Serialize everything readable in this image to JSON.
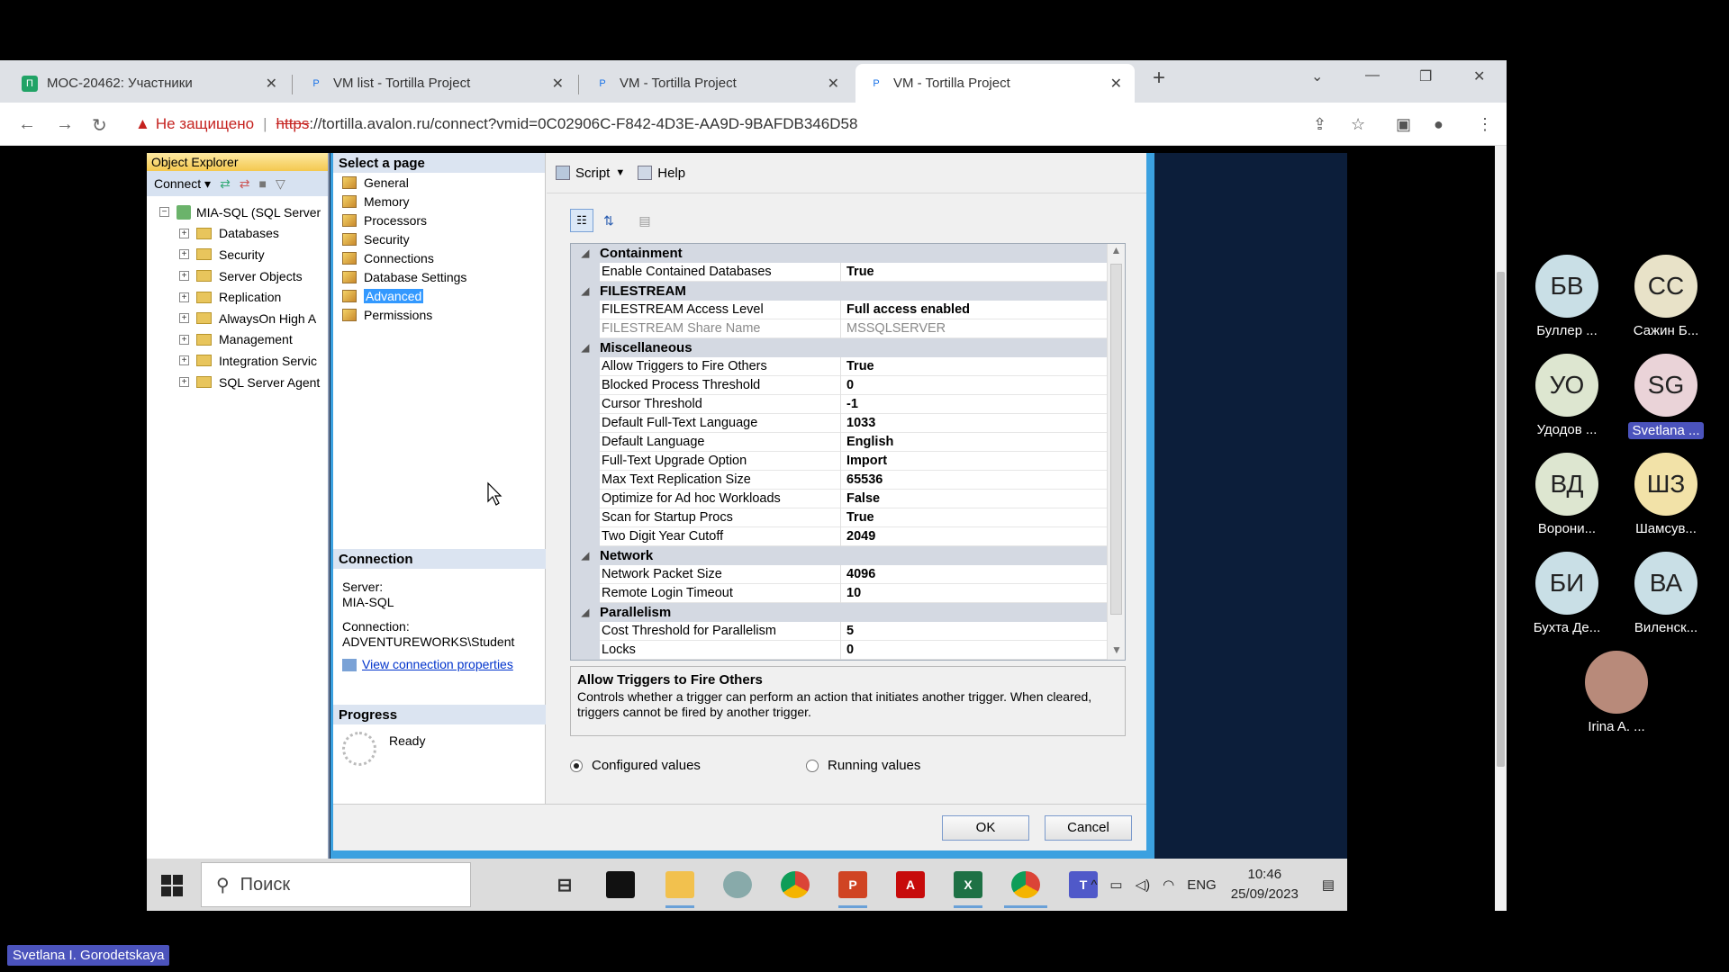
{
  "tabs": [
    {
      "title": "MOC-20462: Участники",
      "fav": "П",
      "favcolor": "#21a366"
    },
    {
      "title": "VM list - Tortilla Project",
      "fav": "P",
      "favcolor": "#1a73e8"
    },
    {
      "title": "VM - Tortilla Project",
      "fav": "P",
      "favcolor": "#1a73e8"
    },
    {
      "title": "VM - Tortilla Project",
      "fav": "P",
      "favcolor": "#1a73e8"
    }
  ],
  "address": {
    "warning": "Не защищено",
    "scheme": "https",
    "rest": "://tortilla.avalon.ru/connect?vmid=0C02906C-F842-4D3E-AA9D-9BAFDB346D58"
  },
  "oe": {
    "title": "Object Explorer",
    "connect": "Connect ▾",
    "server": "MIA-SQL (SQL Server",
    "nodes": [
      "Databases",
      "Security",
      "Server Objects",
      "Replication",
      "AlwaysOn High A",
      "Management",
      "Integration Servic",
      "SQL Server Agent"
    ]
  },
  "dialog": {
    "select_page": "Select a page",
    "pages": [
      "General",
      "Memory",
      "Processors",
      "Security",
      "Connections",
      "Database Settings",
      "Advanced",
      "Permissions"
    ],
    "selected_page": "Advanced",
    "script": "Script",
    "help": "Help",
    "connection_hdr": "Connection",
    "server_label": "Server:",
    "server_value": "MIA-SQL",
    "connection_label": "Connection:",
    "connection_value": "ADVENTUREWORKS\\Student",
    "view_props": "View connection properties",
    "progress_hdr": "Progress",
    "progress_status": "Ready",
    "desc_title": "Allow Triggers to Fire Others",
    "desc_text": "Controls whether a trigger can perform an action that initiates another trigger. When cleared, triggers cannot be fired by another trigger.",
    "radio_configured": "Configured values",
    "radio_running": "Running values",
    "ok": "OK",
    "cancel": "Cancel"
  },
  "grid": [
    {
      "cat": "Containment",
      "rows": [
        [
          "Enable Contained Databases",
          "True",
          false
        ]
      ]
    },
    {
      "cat": "FILESTREAM",
      "rows": [
        [
          "FILESTREAM Access Level",
          "Full access enabled",
          false
        ],
        [
          "FILESTREAM Share Name",
          "MSSQLSERVER",
          true
        ]
      ]
    },
    {
      "cat": "Miscellaneous",
      "rows": [
        [
          "Allow Triggers to Fire Others",
          "True",
          false
        ],
        [
          "Blocked Process Threshold",
          "0",
          false
        ],
        [
          "Cursor Threshold",
          "-1",
          false
        ],
        [
          "Default Full-Text Language",
          "1033",
          false
        ],
        [
          "Default Language",
          "English",
          false
        ],
        [
          "Full-Text Upgrade Option",
          "Import",
          false
        ],
        [
          "Max Text Replication Size",
          "65536",
          false
        ],
        [
          "Optimize for Ad hoc Workloads",
          "False",
          false
        ],
        [
          "Scan for Startup Procs",
          "True",
          false
        ],
        [
          "Two Digit Year Cutoff",
          "2049",
          false
        ]
      ]
    },
    {
      "cat": "Network",
      "rows": [
        [
          "Network Packet Size",
          "4096",
          false
        ],
        [
          "Remote Login Timeout",
          "10",
          false
        ]
      ]
    },
    {
      "cat": "Parallelism",
      "rows": [
        [
          "Cost Threshold for Parallelism",
          "5",
          false
        ],
        [
          "Locks",
          "0",
          false
        ]
      ]
    }
  ],
  "taskbar": {
    "search": "Поиск",
    "lang": "ENG",
    "time": "10:46",
    "date": "25/09/2023"
  },
  "participants": [
    {
      "initials": "БВ",
      "name": "Буллер ...",
      "color": "#c9dfe6"
    },
    {
      "initials": "СС",
      "name": "Сажин Б...",
      "color": "#e8e2c8"
    },
    {
      "initials": "УО",
      "name": "Удодов ...",
      "color": "#dde6d0"
    },
    {
      "initials": "SG",
      "name": "Svetlana ...",
      "color": "#ead3d8",
      "hl": true
    },
    {
      "initials": "ВД",
      "name": "Ворони...",
      "color": "#dde6d0"
    },
    {
      "initials": "ШЗ",
      "name": "Шамсув...",
      "color": "#f2e2a8"
    },
    {
      "initials": "БИ",
      "name": "Бухта Де...",
      "color": "#c9dfe6"
    },
    {
      "initials": "ВА",
      "name": "Виленск...",
      "color": "#c9dfe6"
    },
    {
      "initials": "",
      "name": "Irina A. ...",
      "color": "#b88a7a"
    }
  ],
  "presenter": "Svetlana I. Gorodetskaya"
}
